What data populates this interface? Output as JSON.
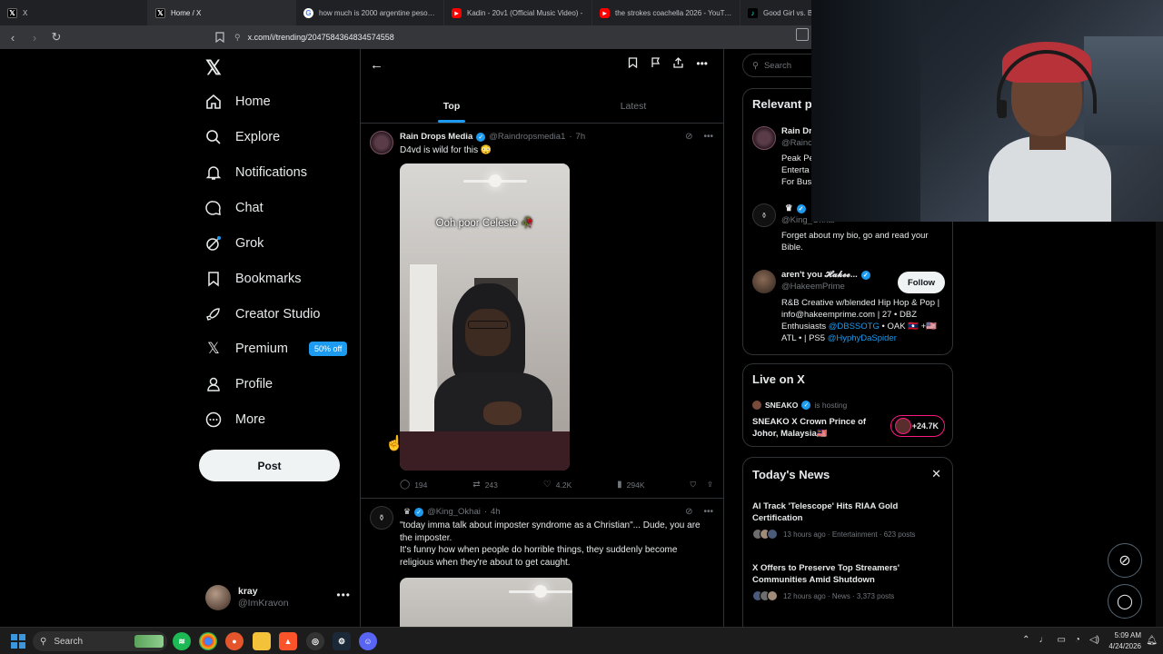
{
  "browser": {
    "tabs": [
      {
        "title": "X",
        "favicon": "x-logo-icon"
      },
      {
        "title": "Home / X",
        "favicon": "x-logo-icon"
      },
      {
        "title": "how much is 2000 argentine pesos in",
        "favicon": "google-icon"
      },
      {
        "title": "Kadin - 20v1 (Official Music Video) -",
        "favicon": "youtube-icon"
      },
      {
        "title": "the strokes coachella 2026 - YouTub",
        "favicon": "youtube-icon"
      },
      {
        "title": "Good Girl vs. Ba",
        "favicon": "tiktok-icon"
      }
    ],
    "url": "x.com/i/trending/2047584364834574558"
  },
  "nav": {
    "items": [
      {
        "label": "Home",
        "icon": "home-icon"
      },
      {
        "label": "Explore",
        "icon": "search-icon"
      },
      {
        "label": "Notifications",
        "icon": "bell-icon"
      },
      {
        "label": "Chat",
        "icon": "chat-icon"
      },
      {
        "label": "Grok",
        "icon": "grok-icon"
      },
      {
        "label": "Bookmarks",
        "icon": "bookmark-icon"
      },
      {
        "label": "Creator Studio",
        "icon": "rocket-icon"
      },
      {
        "label": "Premium",
        "icon": "x-logo-icon"
      },
      {
        "label": "Profile",
        "icon": "person-icon"
      },
      {
        "label": "More",
        "icon": "more-circle-icon"
      }
    ],
    "premium_badge": "50% off",
    "post_label": "Post",
    "account": {
      "name": "kray",
      "handle": "@ImKravon"
    }
  },
  "feed": {
    "tabs": [
      "Top",
      "Latest"
    ],
    "posts": [
      {
        "name": "Rain Drops Media",
        "handle": "@Raindropsmedia1",
        "time": "7h",
        "text": "D4vd is wild for this 😳",
        "video_caption": "Ooh poor Celeste 🥀",
        "stats": {
          "replies": "194",
          "reposts": "243",
          "likes": "4.2K",
          "views": "294K"
        }
      },
      {
        "name": "",
        "handle": "@King_Okhai",
        "time": "4h",
        "text": "\"today imma talk about imposter syndrome as a Christian\"... Dude, you are the imposter.",
        "text2": "It's funny how when people do horrible things, they suddenly become religious when they're about to get caught."
      }
    ]
  },
  "right": {
    "search_placeholder": "Search",
    "relevant": {
      "title": "Relevant p",
      "people": [
        {
          "name": "Rain Dr",
          "handle": "@Rainc",
          "bio": "Peak Pe Enterta For Bus"
        },
        {
          "name": "",
          "handle": "@King_Okhai",
          "bio": "Forget about my bio, go and read your Bible."
        },
        {
          "name": "aren't you 𝓗𝓪𝓴𝓮𝓮...",
          "handle": "@HakeemPrime",
          "follow": "Follow",
          "bio_parts": [
            "R&B Creative w/blended Hip Hop & Pop | info@hakeemprime.com | 27 • DBZ Enthusiasts ",
            "@DBSSOTG",
            " • OAK 🇱🇦 +🇺🇸 ATL • | PS5 ",
            "@HyphyDaSpider"
          ]
        }
      ]
    },
    "live": {
      "title": "Live on X",
      "host": "SNEAKO",
      "status": "is hosting",
      "space_title": "SNEAKO X Crown Prince of Johor, Malaysia🇲🇾",
      "listeners": "+24.7K"
    },
    "news": {
      "title": "Today's News",
      "items": [
        {
          "title": "AI Track 'Telescope' Hits RIAA Gold Certification",
          "meta": "13 hours ago · Entertainment · 623 posts"
        },
        {
          "title": "X Offers to Preserve Top Streamers' Communities Amid Shutdown",
          "meta": "12 hours ago · News · 3,373 posts"
        }
      ]
    }
  },
  "taskbar": {
    "search": "Search",
    "time": "5:09 AM",
    "date": "4/24/2026"
  },
  "colors": {
    "accent": "#1d9bf0",
    "bg": "#000000",
    "border": "#2f3336",
    "muted": "#71767b",
    "live": "#f91880"
  }
}
